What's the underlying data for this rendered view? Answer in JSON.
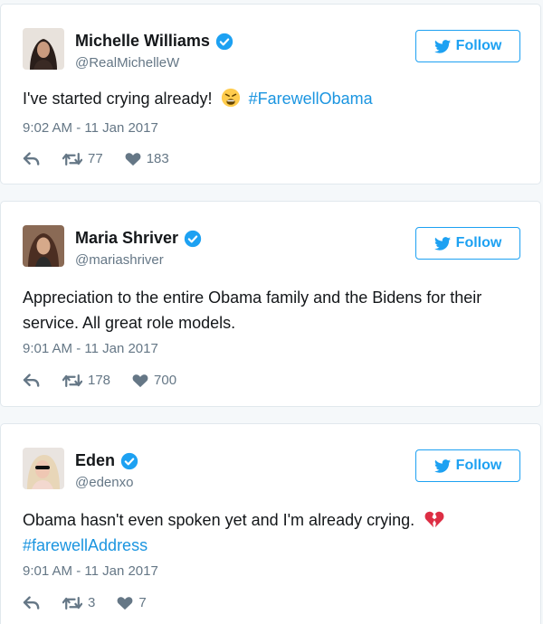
{
  "tweets": [
    {
      "name": "Michelle Williams",
      "handle": "@RealMichelleW",
      "follow_label": "Follow",
      "text": "I've started crying already!",
      "emoji": "weary-face",
      "hashtag": "#FarewellObama",
      "timestamp": "9:02 AM - 11 Jan 2017",
      "retweets": "77",
      "likes": "183"
    },
    {
      "name": "Maria Shriver",
      "handle": "@mariashriver",
      "follow_label": "Follow",
      "text": "Appreciation to the entire Obama family and the Bidens for their service. All great role models.",
      "timestamp": "9:01 AM - 11 Jan 2017",
      "retweets": "178",
      "likes": "700"
    },
    {
      "name": "Eden",
      "handle": "@edenxo",
      "follow_label": "Follow",
      "text": "Obama hasn't even spoken yet and I'm already crying.",
      "emoji": "broken-heart",
      "hashtag": "#farewellAddress",
      "timestamp": "9:01 AM - 11 Jan 2017",
      "retweets": "3",
      "likes": "7"
    }
  ],
  "colors": {
    "accent": "#1da1f2",
    "link": "#1b95e0",
    "muted": "#657786"
  }
}
